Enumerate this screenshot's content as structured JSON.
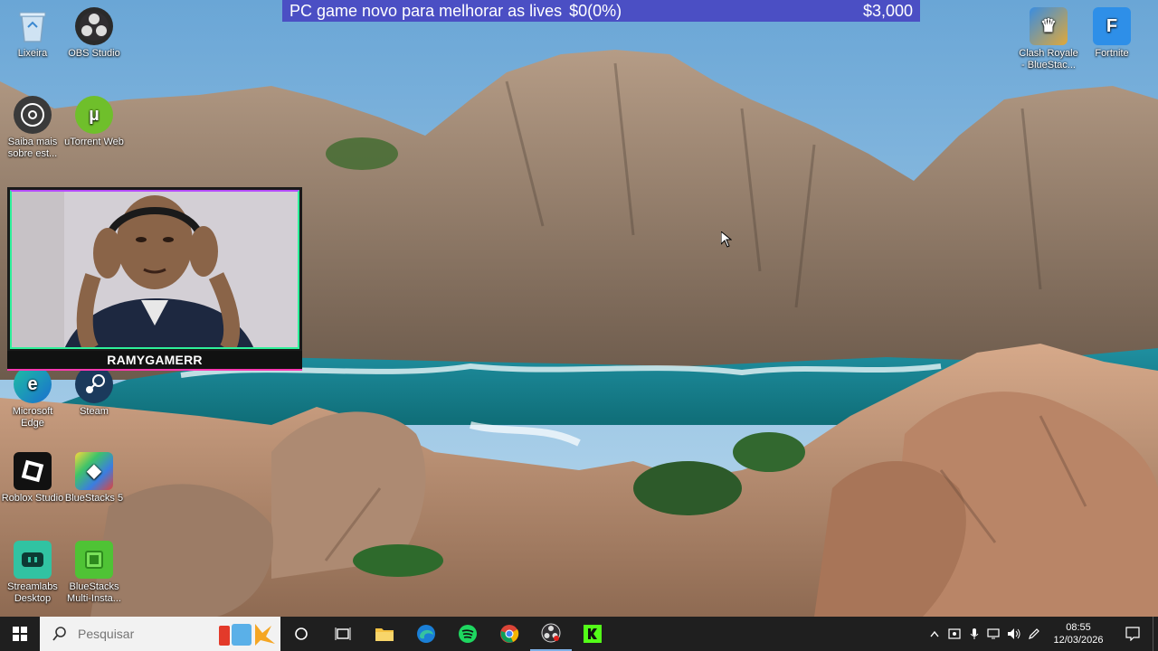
{
  "donation_goal": {
    "title": "PC game novo para melhorar as lives",
    "progress": "$0(0%)",
    "target": "$3,000",
    "progress_fraction": 0
  },
  "desktop_icons_left": [
    {
      "label": "Lixeira",
      "icon": "recycle-bin-icon"
    },
    {
      "label": "OBS Studio",
      "icon": "obs-icon"
    },
    {
      "label": "Saiba mais sobre est...",
      "icon": "learn-more-icon"
    },
    {
      "label": "uTorrent Web",
      "icon": "utorrent-icon"
    },
    {
      "label": "Microsoft Edge",
      "icon": "edge-icon"
    },
    {
      "label": "Steam",
      "icon": "steam-icon"
    },
    {
      "label": "Roblox Studio",
      "icon": "roblox-studio-icon"
    },
    {
      "label": "BlueStacks 5",
      "icon": "bluestacks-icon"
    },
    {
      "label": "Streamlabs Desktop",
      "icon": "streamlabs-icon"
    },
    {
      "label": "BlueStacks Multi-Insta...",
      "icon": "bluestacks-multi-icon"
    }
  ],
  "desktop_icons_right": [
    {
      "label": "Clash Royale - BlueStac...",
      "icon": "clash-royale-icon"
    },
    {
      "label": "Fortnite",
      "icon": "fortnite-icon"
    }
  ],
  "webcam": {
    "streamer_name": "RAMYGAMERR"
  },
  "taskbar": {
    "search_placeholder": "Pesquisar",
    "apps": [
      "cortana-icon",
      "task-view-icon",
      "file-explorer-icon",
      "edge-icon",
      "spotify-icon",
      "chrome-icon",
      "obs-icon",
      "kick-icon"
    ]
  },
  "clock": {
    "time": "08:55",
    "date": "12/03/2026"
  },
  "colors": {
    "goal_bar": "#4b4fc4",
    "taskbar": "#1f1f1f"
  }
}
